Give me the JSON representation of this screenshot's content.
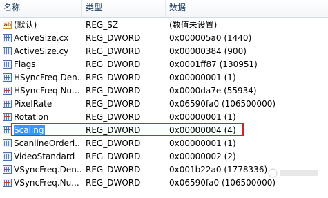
{
  "columns": {
    "name": "名称",
    "type": "类型",
    "data": "数据"
  },
  "rows": [
    {
      "icon": "string-value-icon",
      "name": "(默认)",
      "type": "REG_SZ",
      "data": "(数值未设置)"
    },
    {
      "icon": "binary-value-icon",
      "name": "ActiveSize.cx",
      "type": "REG_DWORD",
      "data": "0x000005a0 (1440)"
    },
    {
      "icon": "binary-value-icon",
      "name": "ActiveSize.cy",
      "type": "REG_DWORD",
      "data": "0x00000384 (900)"
    },
    {
      "icon": "binary-value-icon",
      "name": "Flags",
      "type": "REG_DWORD",
      "data": "0x0001ff87 (130951)"
    },
    {
      "icon": "binary-value-icon",
      "name": "HSyncFreq.Den...",
      "type": "REG_DWORD",
      "data": "0x00000001 (1)"
    },
    {
      "icon": "binary-value-icon",
      "name": "HSyncFreq.Nu...",
      "type": "REG_DWORD",
      "data": "0x0000da7e (55934)"
    },
    {
      "icon": "binary-value-icon",
      "name": "PixelRate",
      "type": "REG_DWORD",
      "data": "0x06590fa0 (106500000)"
    },
    {
      "icon": "binary-value-icon",
      "name": "Rotation",
      "type": "REG_DWORD",
      "data": "0x00000001 (1)"
    },
    {
      "icon": "binary-value-icon",
      "name": "Scaling",
      "type": "REG_DWORD",
      "data": "0x00000004 (4)",
      "selected": true
    },
    {
      "icon": "binary-value-icon",
      "name": "ScanlineOrderi...",
      "type": "REG_DWORD",
      "data": "0x00000001 (1)"
    },
    {
      "icon": "binary-value-icon",
      "name": "VideoStandard",
      "type": "REG_DWORD",
      "data": "0x00000002 (2)"
    },
    {
      "icon": "binary-value-icon",
      "name": "VSyncFreq.Den...",
      "type": "REG_DWORD",
      "data": "0x001b22a0 (1778336)"
    },
    {
      "icon": "binary-value-icon",
      "name": "VSyncFreq.Nu...",
      "type": "REG_DWORD",
      "data": "0x06590fa0 (106500000)"
    }
  ],
  "colors": {
    "selection": "#3399ff",
    "annotation_box": "#d2232a"
  }
}
